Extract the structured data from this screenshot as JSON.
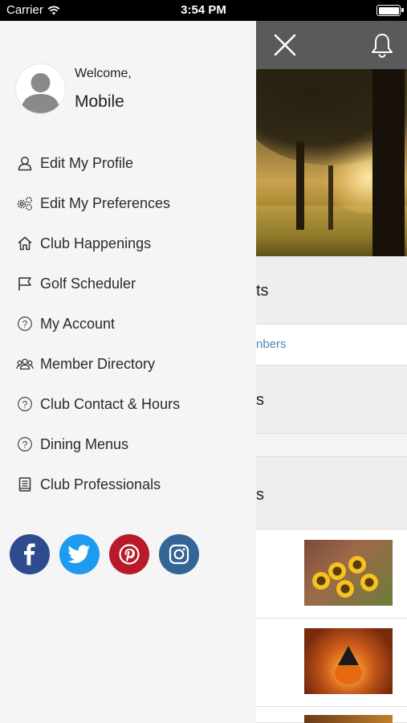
{
  "status_bar": {
    "carrier": "Carrier",
    "time": "3:54 PM"
  },
  "drawer": {
    "welcome": "Welcome,",
    "username": "Mobile",
    "menu": [
      {
        "label": "Edit My Profile",
        "icon": "user-icon"
      },
      {
        "label": "Edit My Preferences",
        "icon": "gears-icon"
      },
      {
        "label": "Club Happenings",
        "icon": "home-icon"
      },
      {
        "label": "Golf Scheduler",
        "icon": "flag-icon"
      },
      {
        "label": "My Account",
        "icon": "question-icon"
      },
      {
        "label": "Member Directory",
        "icon": "group-icon"
      },
      {
        "label": "Club Contact & Hours",
        "icon": "question-icon"
      },
      {
        "label": "Dining Menus",
        "icon": "question-icon"
      },
      {
        "label": "Club Professionals",
        "icon": "book-icon"
      }
    ],
    "social": [
      {
        "name": "facebook-icon",
        "color": "#2d4b8e"
      },
      {
        "name": "twitter-icon",
        "color": "#1d9bf0"
      },
      {
        "name": "pinterest-icon",
        "color": "#b81a2a"
      },
      {
        "name": "instagram-icon",
        "color": "#356596"
      }
    ]
  },
  "background": {
    "top_bar_color": "#5a5a5a",
    "section1_text": "ts",
    "link_text": "nbers",
    "section2_text": "s",
    "section3_text": "s",
    "link_color": "#4a88b5"
  }
}
